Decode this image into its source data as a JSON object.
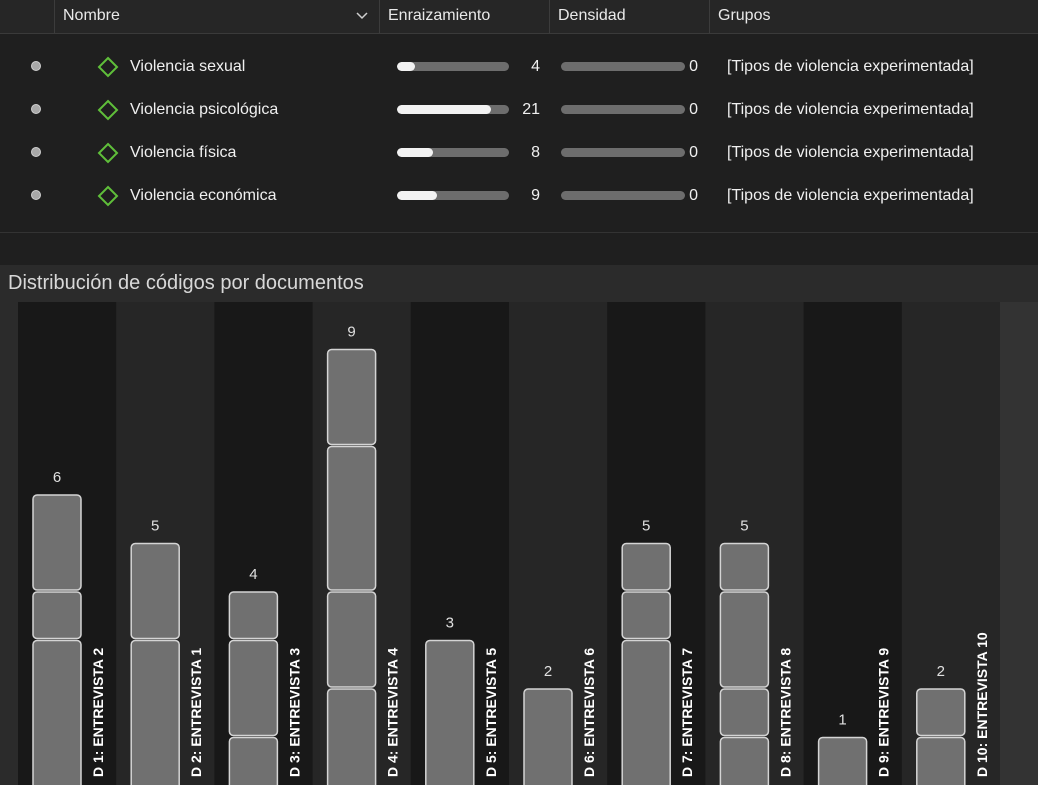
{
  "table": {
    "columns": {
      "name": "Nombre",
      "rooting": "Enraizamiento",
      "density": "Densidad",
      "groups": "Grupos"
    },
    "rooting_max": 25,
    "rows": [
      {
        "name": "Violencia sexual",
        "rooting": 4,
        "density": 0,
        "groups": "[Tipos de violencia experimentada]"
      },
      {
        "name": "Violencia psicológica",
        "rooting": 21,
        "density": 0,
        "groups": "[Tipos de violencia experimentada]"
      },
      {
        "name": "Violencia física",
        "rooting": 8,
        "density": 0,
        "groups": "[Tipos de violencia experimentada]"
      },
      {
        "name": "Violencia económica",
        "rooting": 9,
        "density": 0,
        "groups": "[Tipos de violencia experimentada]"
      }
    ],
    "colors": {
      "code_icon": "#5fbf3a",
      "bar_fill": "#f2f2f2",
      "bar_track": "#6d6d6d"
    }
  },
  "chart_title": "Distribución de códigos por documentos",
  "chart_data": {
    "type": "bar",
    "stacked": true,
    "title": "Distribución de códigos por documentos",
    "categories": [
      "D 1: ENTREVISTA 2",
      "D 2: ENTREVISTA 1",
      "D 3: ENTREVISTA 3",
      "D 4: ENTREVISTA 4",
      "D 5: ENTREVISTA 5",
      "D 6: ENTREVISTA 6",
      "D 7: ENTREVISTA 7",
      "D 8: ENTREVISTA 8",
      "D 9: ENTREVISTA 9",
      "D 10: ENTREVISTA 10"
    ],
    "values": [
      6,
      5,
      4,
      9,
      3,
      2,
      5,
      5,
      1,
      2
    ],
    "segments": [
      [
        3,
        1,
        2
      ],
      [
        3,
        2
      ],
      [
        1,
        2,
        1
      ],
      [
        2,
        2,
        3,
        2
      ],
      [
        3
      ],
      [
        2
      ],
      [
        3,
        1,
        1
      ],
      [
        1,
        1,
        2,
        1
      ],
      [
        1
      ],
      [
        1,
        1
      ]
    ],
    "colors": {
      "bar": "#707070",
      "border": "#d4d4d4",
      "column_dark": "#181818",
      "column_light": "#262626"
    }
  }
}
